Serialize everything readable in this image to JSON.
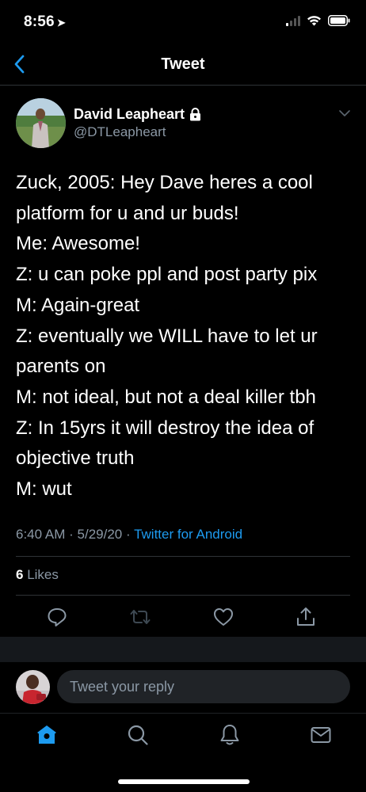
{
  "status_bar": {
    "time": "8:56",
    "location_glyph": "➤"
  },
  "nav": {
    "title": "Tweet",
    "back_icon": "chevron-left-icon"
  },
  "tweet": {
    "author_name": "David Leapheart",
    "author_handle": "@DTLeapheart",
    "protected_icon": "lock-icon",
    "text": "Zuck, 2005: Hey Dave heres a cool platform for u and ur buds!\nMe: Awesome!\nZ: u can poke ppl and post party pix\nM: Again-great\nZ: eventually we WILL have to let ur parents on\nM: not ideal, but not a deal killer tbh\nZ:  In 15yrs it will destroy the idea of objective truth\nM: wut",
    "time": "6:40 AM",
    "date": "5/29/20",
    "separator": "·",
    "client": "Twitter for Android",
    "likes_count": "6",
    "likes_label": "Likes"
  },
  "actions": [
    "reply-icon",
    "retweet-icon",
    "like-icon",
    "share-icon"
  ],
  "reply": {
    "placeholder": "Tweet your reply"
  },
  "tabs": [
    "home-icon",
    "search-icon",
    "notifications-icon",
    "messages-icon"
  ],
  "colors": {
    "accent": "#1d9bf0",
    "secondary_text": "#8b98a5",
    "background": "#000000"
  }
}
